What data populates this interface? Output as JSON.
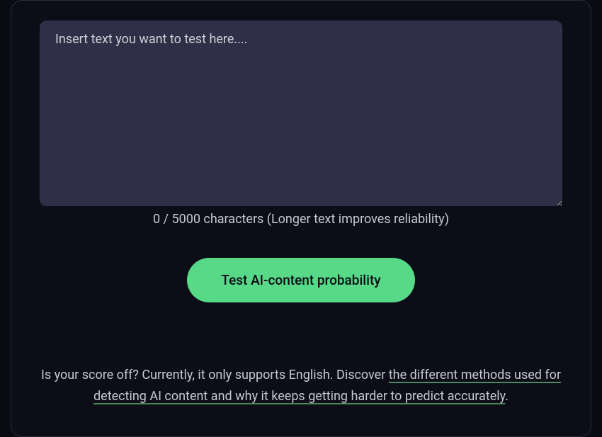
{
  "input": {
    "placeholder": "Insert text you want to test here....",
    "value": ""
  },
  "counter": {
    "current": 0,
    "max": 5000,
    "text": "0 / 5000 characters (Longer text improves reliability)"
  },
  "button": {
    "label": "Test AI-content probability"
  },
  "help": {
    "prefix": "Is your score off? Currently, it only supports English. Discover ",
    "link": "the different methods used for detecting AI content and why it keeps getting harder to predict accurately",
    "suffix": "."
  }
}
